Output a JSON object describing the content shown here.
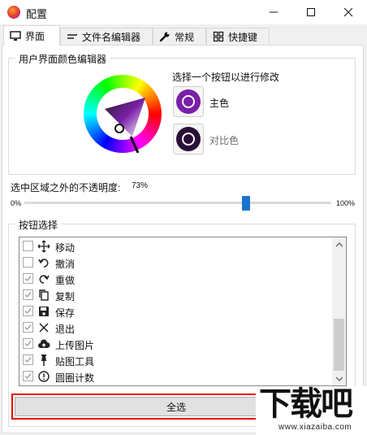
{
  "window": {
    "title": "配置",
    "icon": "app-logo-icon",
    "controls": [
      "minimize-icon",
      "maximize-icon",
      "close-icon"
    ]
  },
  "tabs": [
    {
      "label": "界面",
      "icon": "monitor-icon",
      "active": true
    },
    {
      "label": "文件名编辑器",
      "icon": "text-lines-icon",
      "active": false
    },
    {
      "label": "常规",
      "icon": "wrench-icon",
      "active": false
    },
    {
      "label": "快捷键",
      "icon": "grid-icon",
      "active": false
    }
  ],
  "color_editor": {
    "group_title": "用户界面颜色编辑器",
    "instruction": "选择一个按钮以进行修改",
    "buttons": [
      {
        "label": "主色",
        "color": "#7a1fa8",
        "selected": true
      },
      {
        "label": "对比色",
        "color": "#2a0f38",
        "selected": false
      }
    ]
  },
  "opacity": {
    "label": "选中区域之外的不透明度:",
    "value_text": "73%",
    "value": 73,
    "min_label": "0%",
    "max_label": "100%"
  },
  "button_select": {
    "group_title": "按钮选择",
    "items": [
      {
        "label": "移动",
        "icon": "move-arrows-icon",
        "checked": false
      },
      {
        "label": "撤消",
        "icon": "undo-icon",
        "checked": false
      },
      {
        "label": "重做",
        "icon": "redo-icon",
        "checked": true
      },
      {
        "label": "复制",
        "icon": "copy-icon",
        "checked": true
      },
      {
        "label": "保存",
        "icon": "save-icon",
        "checked": true
      },
      {
        "label": "退出",
        "icon": "close-x-icon",
        "checked": true
      },
      {
        "label": "上传图片",
        "icon": "cloud-upload-icon",
        "checked": true
      },
      {
        "label": "贴图工具",
        "icon": "pin-icon",
        "checked": true
      },
      {
        "label": "圆圈计数",
        "icon": "circle-counter-icon",
        "checked": true
      }
    ],
    "select_all_label": "全选"
  },
  "watermark": {
    "main": "下载吧",
    "sub": "www.xiazaiba.com"
  }
}
